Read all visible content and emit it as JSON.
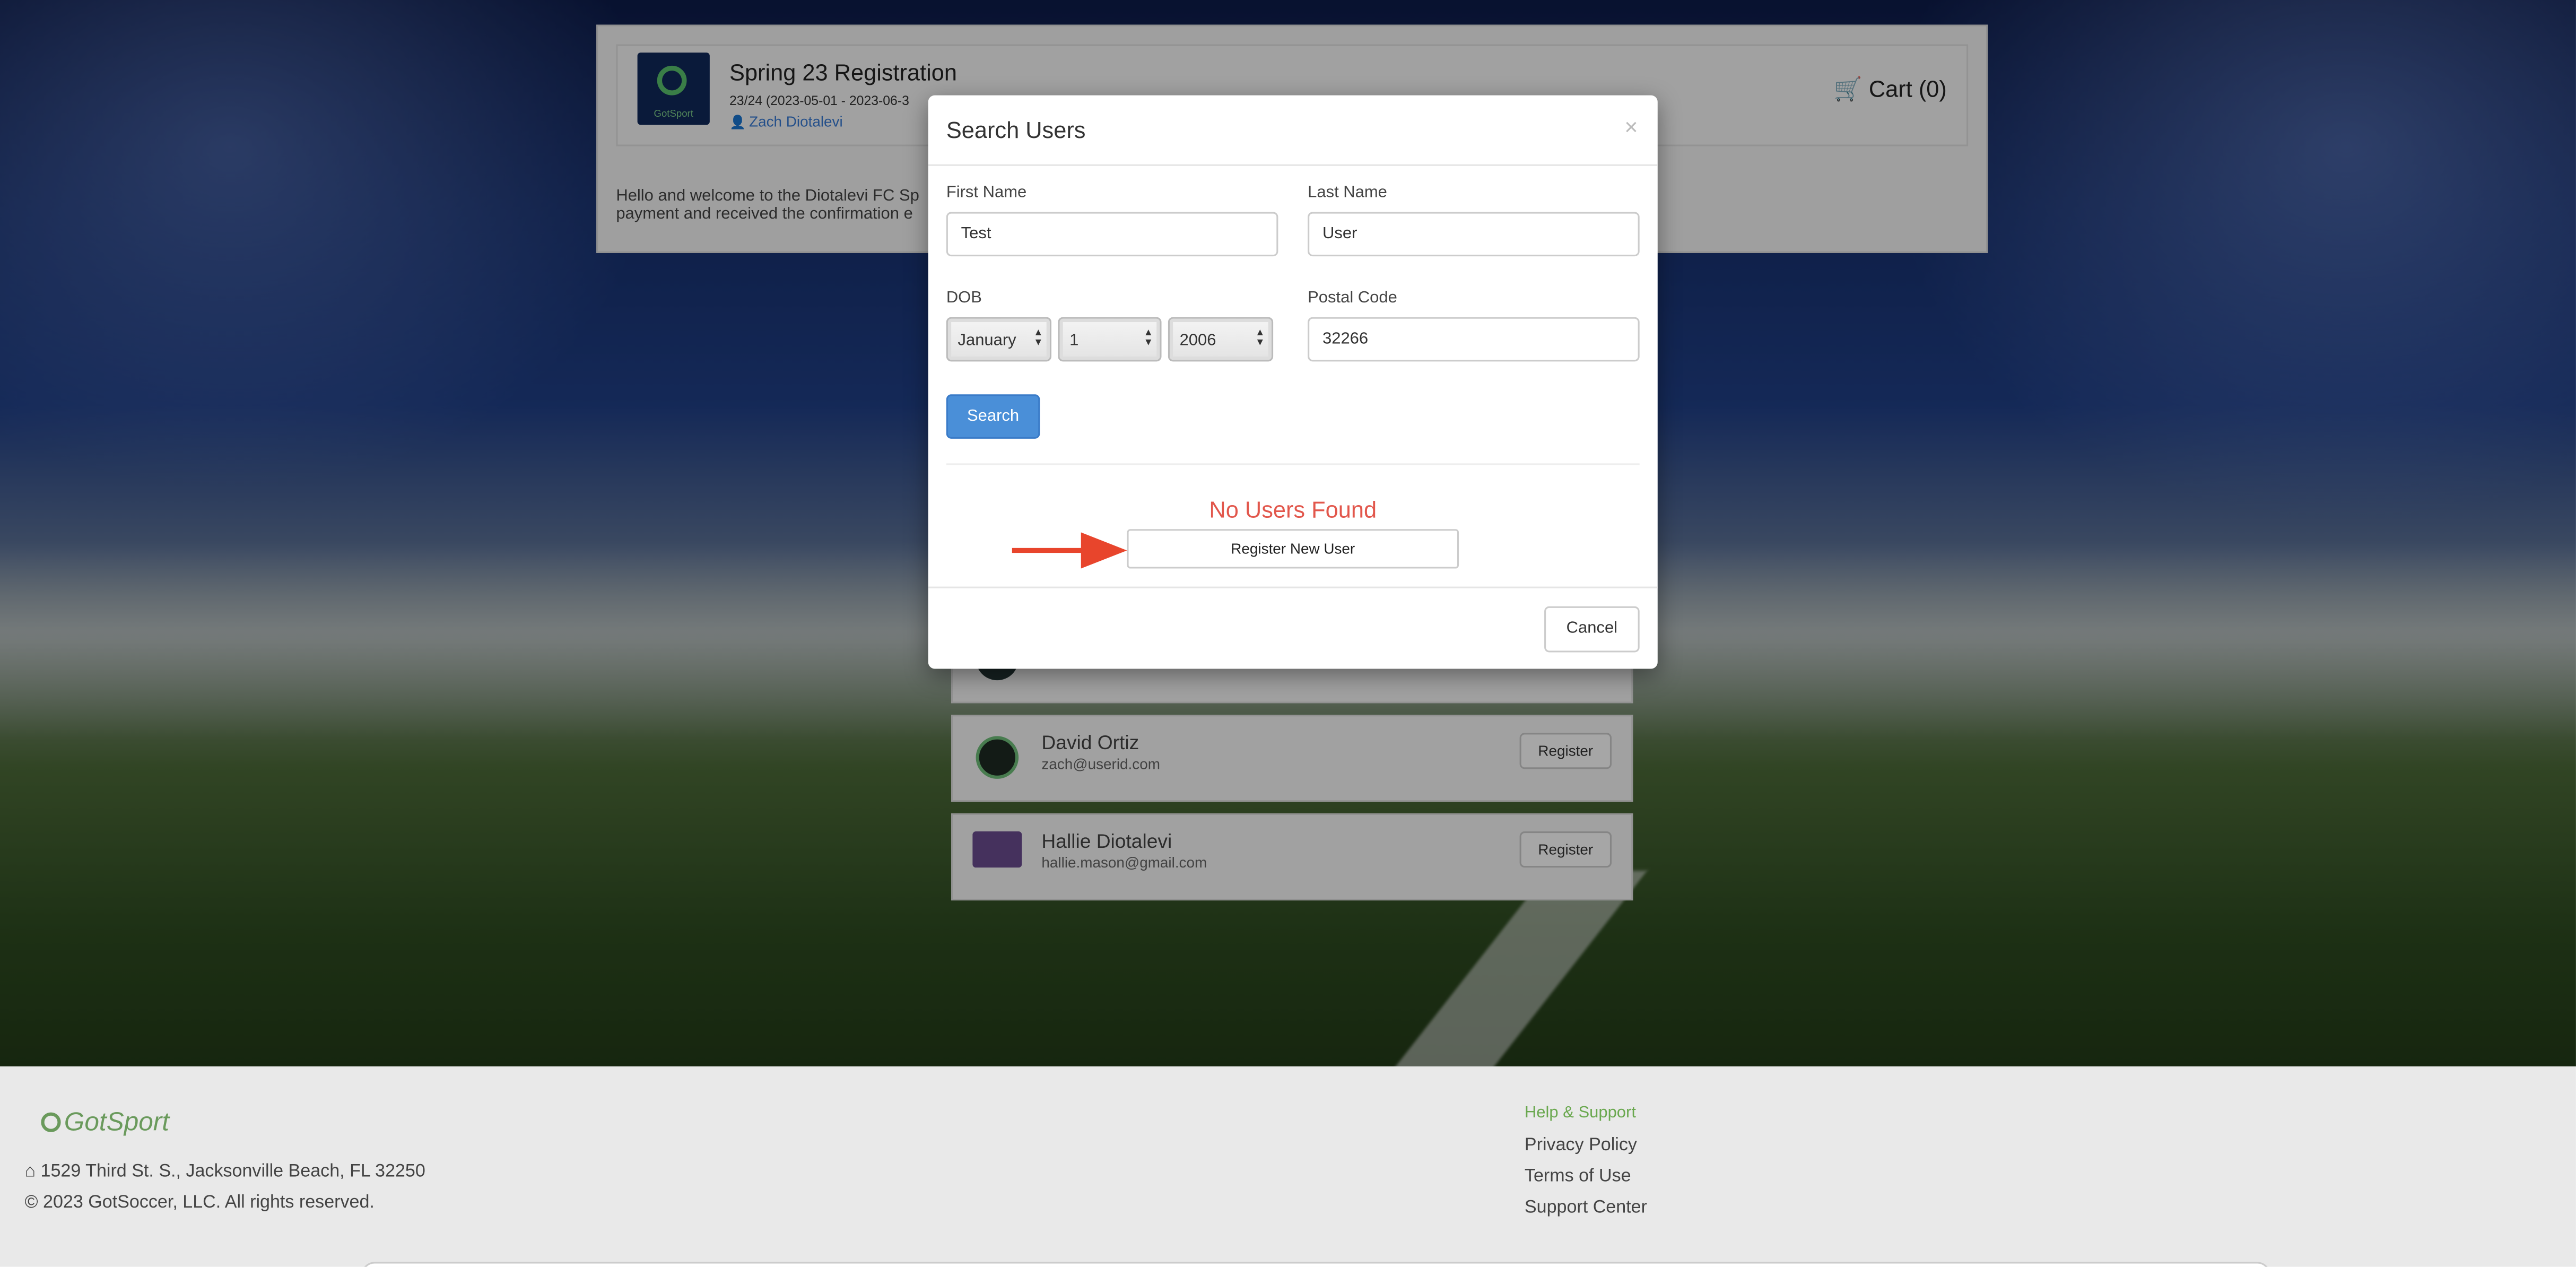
{
  "registration": {
    "title": "Spring 23 Registration",
    "dates": "23/24 (2023-05-01 - 2023-06-3",
    "owner": "Zach Diotalevi",
    "logo_text": "GotSport",
    "cart_label": "Cart (0)",
    "welcome_line1": "Hello and welcome to the Diotalevi FC Sp",
    "welcome_line2": "payment and received the confirmation e"
  },
  "users": [
    {
      "name": "David Ortiz",
      "email": "zach@userid.com",
      "button": "Register"
    },
    {
      "name": "Hallie Diotalevi",
      "email": "hallie.mason@gmail.com",
      "button": "Register"
    }
  ],
  "modal": {
    "title": "Search Users",
    "close_glyph": "×",
    "first_name_label": "First Name",
    "first_name_value": "Test",
    "last_name_label": "Last Name",
    "last_name_value": "User",
    "dob_label": "DOB",
    "dob_month": "January",
    "dob_day": "1",
    "dob_year": "2006",
    "postal_label": "Postal Code",
    "postal_value": "32266",
    "search_button": "Search",
    "no_results": "No Users Found",
    "register_new_button": "Register New User",
    "cancel_button": "Cancel"
  },
  "footer": {
    "logo": "GotSport",
    "address": "1529 Third St. S., Jacksonville Beach, FL 32250",
    "copyright": "© 2023 GotSoccer, LLC. All rights reserved.",
    "help_heading": "Help & Support",
    "links": [
      "Privacy Policy",
      "Terms of Use",
      "Support Center"
    ]
  },
  "colors": {
    "primary_button": "#4a8fd8",
    "no_results": "#e2574c",
    "arrow": "#e8452c",
    "help_heading": "#6aa84f"
  },
  "icons": [
    "shopping-cart-icon",
    "user-icon",
    "close-icon",
    "home-icon",
    "red-arrow-annotation"
  ]
}
